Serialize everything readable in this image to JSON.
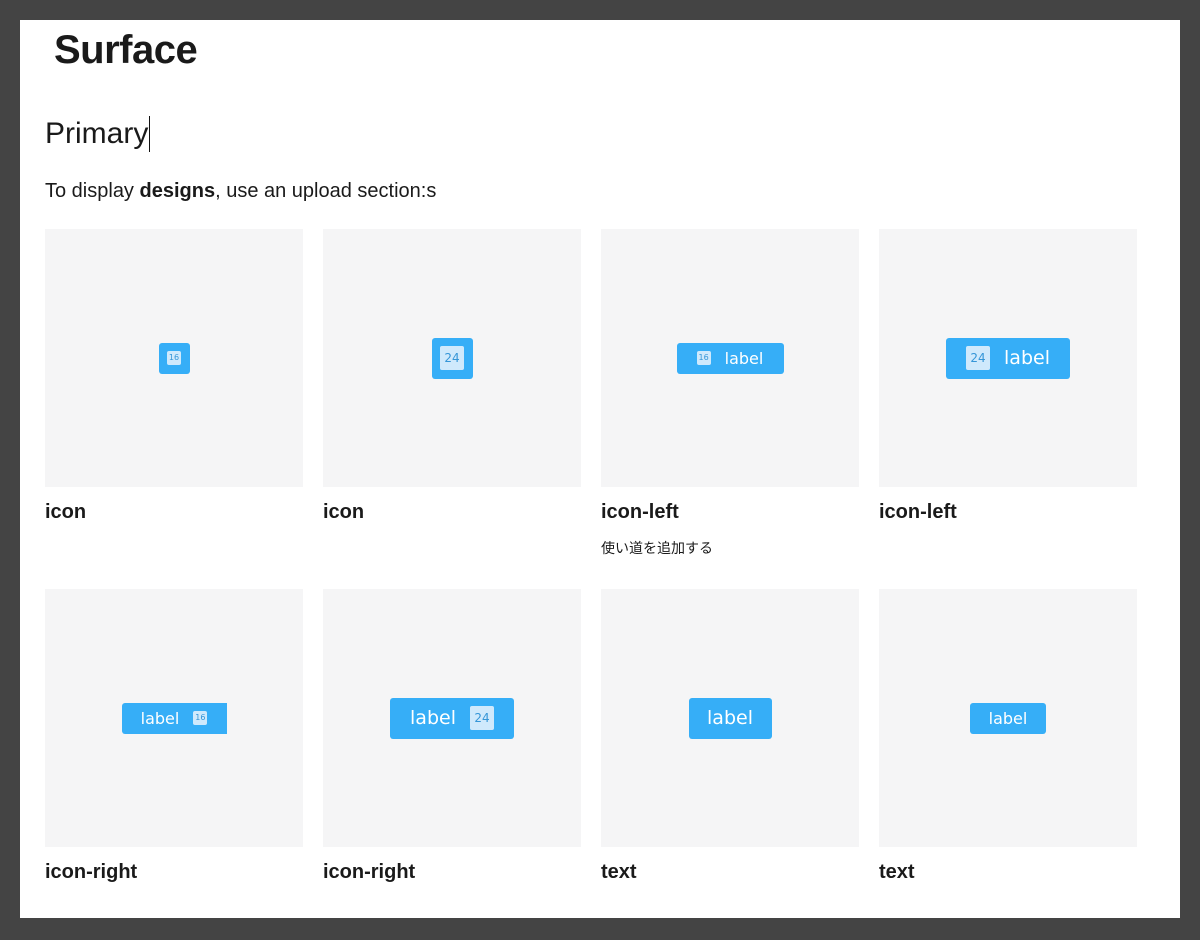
{
  "page": {
    "title": "Surface",
    "section_title": "Primary",
    "intro": {
      "before": "To display ",
      "bold": "designs",
      "after": ", use an upload section:s"
    }
  },
  "colors": {
    "button_bg": "#36aef7",
    "icon_box_bg": "#cfe9fc",
    "icon_box_text": "#3596d8",
    "preview_bg": "#f5f5f6",
    "frame_bg": "#ffffff",
    "outer_bg": "#444444"
  },
  "cards": [
    {
      "title": "icon",
      "button": {
        "icon": "16"
      }
    },
    {
      "title": "icon",
      "button": {
        "icon": "24"
      }
    },
    {
      "title": "icon-left",
      "description": "使い道を追加する",
      "button": {
        "icon": "16",
        "label": "label"
      }
    },
    {
      "title": "icon-left",
      "button": {
        "icon": "24",
        "label": "label"
      }
    },
    {
      "title": "icon-right",
      "button": {
        "label": "label",
        "icon": "16"
      }
    },
    {
      "title": "icon-right",
      "button": {
        "label": "label",
        "icon": "24"
      }
    },
    {
      "title": "text",
      "button": {
        "label": "label"
      }
    },
    {
      "title": "text",
      "button": {
        "label": "label"
      }
    }
  ]
}
